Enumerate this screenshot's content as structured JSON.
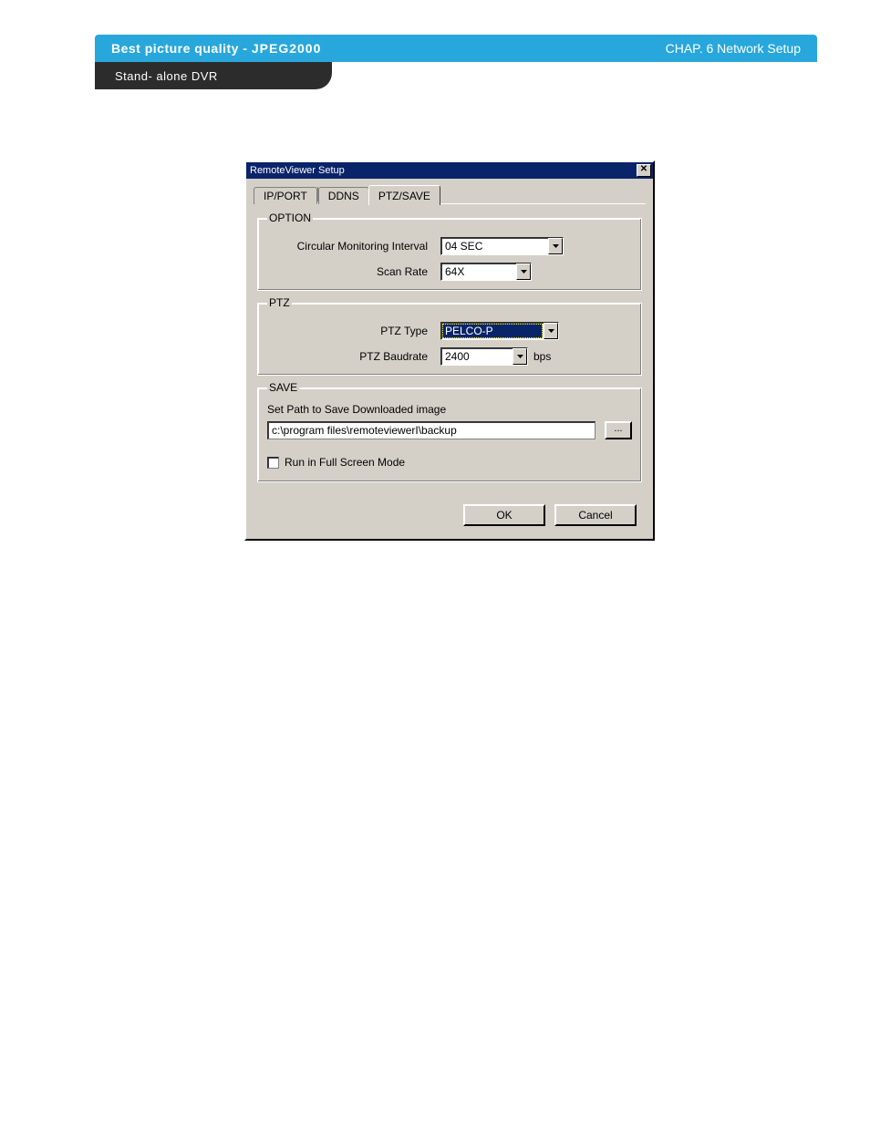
{
  "header": {
    "left_prefix": "Best picture quality - ",
    "left_bold": "JPEG2000",
    "right": "CHAP. 6  Network Setup"
  },
  "subheader": {
    "text": "Stand- alone DVR"
  },
  "dialog": {
    "title": "RemoteViewer Setup",
    "close_symbol": "✕",
    "tabs": {
      "ip_port": "IP/PORT",
      "ddns": "DDNS",
      "ptz_save": "PTZ/SAVE"
    },
    "option": {
      "legend": "OPTION",
      "interval_label": "Circular Monitoring Interval",
      "interval_value": "04 SEC",
      "scanrate_label": "Scan Rate",
      "scanrate_value": "64X"
    },
    "ptz": {
      "legend": "PTZ",
      "type_label": "PTZ Type",
      "type_value": "PELCO-P",
      "baud_label": "PTZ Baudrate",
      "baud_value": "2400",
      "baud_unit": "bps"
    },
    "save": {
      "legend": "SAVE",
      "path_label": "Set Path to Save Downloaded image",
      "path_value": "c:\\program files\\remoteviewerI\\backup",
      "browse_label": "...",
      "fullscreen_label": "Run in Full Screen Mode"
    },
    "buttons": {
      "ok": "OK",
      "cancel": "Cancel"
    }
  }
}
